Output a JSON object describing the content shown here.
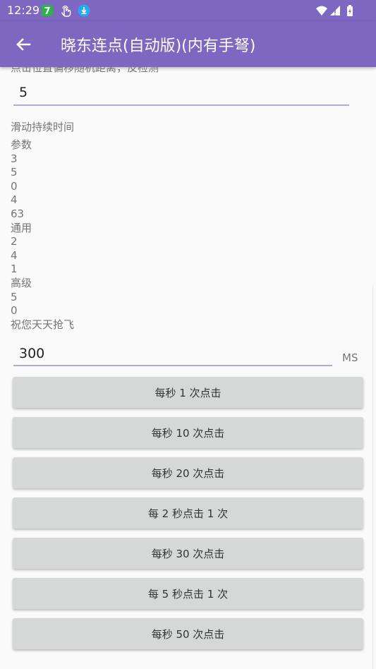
{
  "status": {
    "time": "12:29",
    "icons": [
      "app-badge-icon",
      "touch-icon",
      "download-icon",
      "wifi-icon",
      "signal-icon",
      "battery-icon"
    ]
  },
  "appbar": {
    "title": "晓东连点(自动版)(内有手弩)"
  },
  "form": {
    "cut_label": "点击位置偏移随机距离，反检测",
    "offset_value": "5",
    "duration_label": "滑动持续时间",
    "info_lines": [
      "参数",
      "3",
      "5",
      "0",
      "4",
      "63",
      "通用",
      "2",
      "4",
      "1",
      "高级",
      "5",
      "0",
      "祝您天天抢飞"
    ],
    "interval_value": "300",
    "interval_unit": "MS"
  },
  "buttons": [
    {
      "label": "每秒 1 次点击"
    },
    {
      "label": "每秒 10 次点击"
    },
    {
      "label": "每秒 20 次点击"
    },
    {
      "label": "每 2 秒点击 1 次"
    },
    {
      "label": "每秒 30 次点击"
    },
    {
      "label": "每 5 秒点击 1 次"
    },
    {
      "label": "每秒 50 次点击"
    }
  ],
  "colors": {
    "appbar": "#7e67c0",
    "input_underline": "#b3a8d8",
    "button_bg": "#d6d7d7"
  }
}
